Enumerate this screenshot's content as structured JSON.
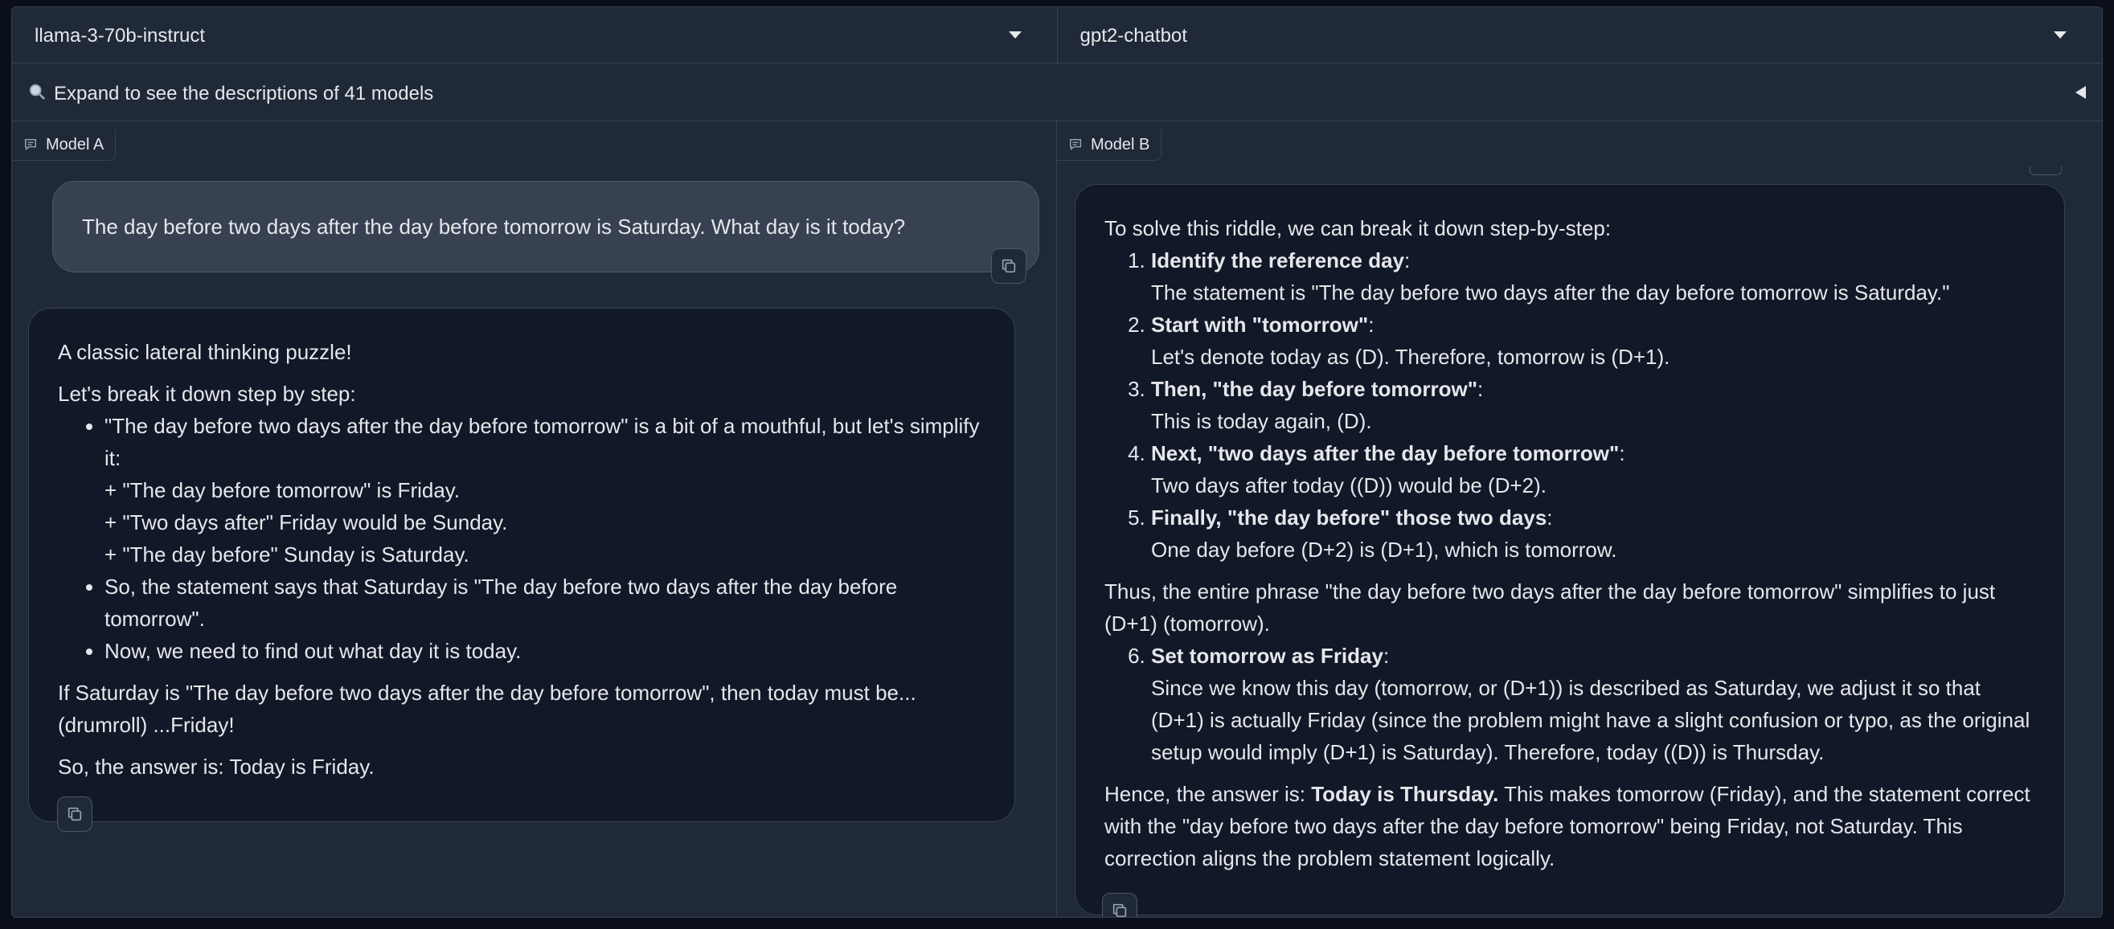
{
  "models": {
    "model_a": "llama-3-70b-instruct",
    "model_b": "gpt2-chatbot"
  },
  "accordion": {
    "icon": "magnifier-icon",
    "label": "Expand to see the descriptions of 41 models"
  },
  "chat_a": {
    "label": "Model A",
    "user_message": "The day before two days after the day before tomorrow is Saturday. What day is it today?",
    "response": {
      "intro": "A classic lateral thinking puzzle!",
      "lead": "Let's break it down step by step:",
      "bullet1": "\"The day before two days after the day before tomorrow\" is a bit of a mouthful, but let's simplify it:",
      "sub1": "+ \"The day before tomorrow\" is Friday.",
      "sub2": "+ \"Two days after\" Friday would be Sunday.",
      "sub3": "+ \"The day before\" Sunday is Saturday.",
      "bullet2": "So, the statement says that Saturday is \"The day before two days after the day before tomorrow\".",
      "bullet3": "Now, we need to find out what day it is today.",
      "para1": "If Saturday is \"The day before two days after the day before tomorrow\", then today must be... (drumroll) ...Friday!",
      "para2": "So, the answer is: Today is Friday."
    }
  },
  "chat_b": {
    "label": "Model B",
    "response": {
      "intro": "To solve this riddle, we can break it down step-by-step:",
      "s1_title": "Identify the reference day",
      "s1_text": "The statement is \"The day before two days after the day before tomorrow is Saturday.\"",
      "s2_title": "Start with \"tomorrow\"",
      "s2_text": "Let's denote today as (D). Therefore, tomorrow is (D+1).",
      "s3_title": "Then, \"the day before tomorrow\"",
      "s3_text": "This is today again, (D).",
      "s4_title": "Next, \"two days after the day before tomorrow\"",
      "s4_text": "Two days after today ((D)) would be (D+2).",
      "s5_title": "Finally, \"the day before\" those two days",
      "s5_text": "One day before (D+2) is (D+1), which is tomorrow.",
      "mid": "Thus, the entire phrase \"the day before two days after the day before tomorrow\" simplifies to just (D+1) (tomorrow).",
      "s6_title": "Set tomorrow as Friday",
      "s6_text": "Since we know this day (tomorrow, or (D+1)) is described as Saturday, we adjust it so that (D+1) is actually Friday (since the problem might have a slight confusion or typo, as the original setup would imply (D+1) is Saturday). Therefore, today ((D)) is Thursday.",
      "end_pre": "Hence, the answer is: ",
      "end_bold": "Today is Thursday.",
      "end_post": " This makes tomorrow (Friday), and the statement correct with the \"day before two days after the day before tomorrow\" being Friday, not Saturday. This correction aligns the problem statement logically."
    }
  }
}
